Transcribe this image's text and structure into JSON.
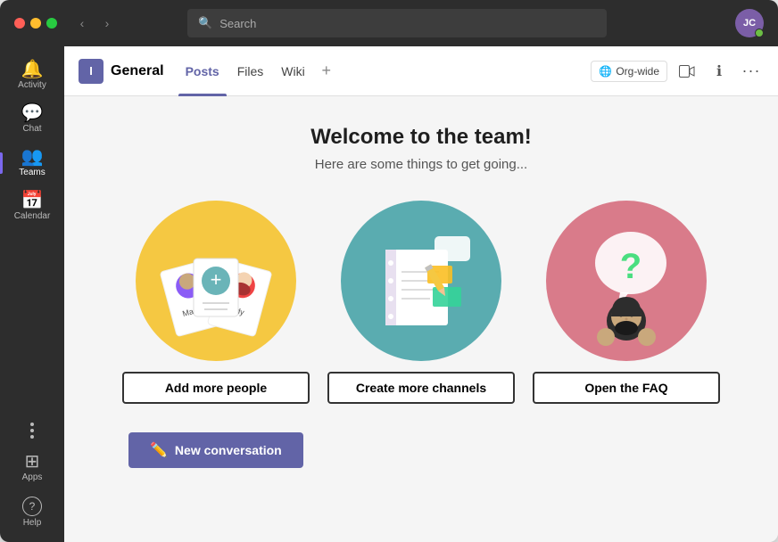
{
  "titlebar": {
    "search_placeholder": "Search",
    "avatar_initials": "JC",
    "back_arrow": "‹",
    "forward_arrow": "›"
  },
  "sidebar": {
    "items": [
      {
        "id": "activity",
        "label": "Activity",
        "icon": "🔔"
      },
      {
        "id": "chat",
        "label": "Chat",
        "icon": "💬"
      },
      {
        "id": "teams",
        "label": "Teams",
        "icon": "👥",
        "active": true
      },
      {
        "id": "calendar",
        "label": "Calendar",
        "icon": "📅"
      }
    ],
    "more_label": "...",
    "bottom_items": [
      {
        "id": "apps",
        "label": "Apps",
        "icon": "⊞"
      },
      {
        "id": "help",
        "label": "Help",
        "icon": "?"
      }
    ]
  },
  "channel": {
    "team_icon_letter": "I",
    "name": "General",
    "tabs": [
      {
        "label": "Posts",
        "active": true
      },
      {
        "label": "Files",
        "active": false
      },
      {
        "label": "Wiki",
        "active": false
      }
    ],
    "add_tab_label": "+",
    "org_wide_label": "Org-wide",
    "info_icon": "ℹ",
    "more_icon": "···"
  },
  "welcome": {
    "title": "Welcome to the team!",
    "subtitle": "Here are some things to get going..."
  },
  "cards": [
    {
      "id": "add-people",
      "button_label": "Add more people",
      "circle_color": "#f5c842"
    },
    {
      "id": "create-channels",
      "button_label": "Create more channels",
      "circle_color": "#5aacb0"
    },
    {
      "id": "open-faq",
      "button_label": "Open the FAQ",
      "circle_color": "#d97b8a"
    }
  ],
  "new_conversation": {
    "label": "New conversation",
    "icon": "✏"
  }
}
